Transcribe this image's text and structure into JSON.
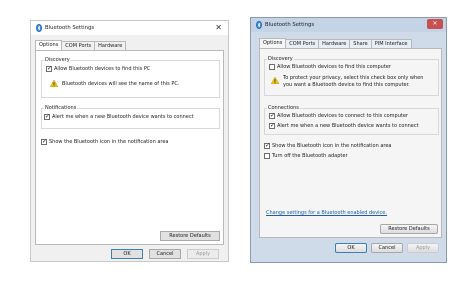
{
  "win10": {
    "title": "Bluetooth Settings",
    "close": "✕",
    "tabs": [
      "Options",
      "COM Ports",
      "Hardware"
    ],
    "discovery": {
      "label": "Discovery",
      "allow_find": "Allow Bluetooth devices to find this PC",
      "allow_find_checked": true,
      "warning": "Bluetooth devices will see the name of this PC."
    },
    "notifications": {
      "label": "Notifications",
      "alert": "Alert me when a new Bluetooth device wants to connect",
      "alert_checked": true
    },
    "show_icon": "Show the Bluetooth icon in the notification area",
    "show_icon_checked": true,
    "restore": "Restore Defaults",
    "ok": "OK",
    "cancel": "Cancel",
    "apply": "Apply"
  },
  "win7": {
    "title": "Bluetooth Settings",
    "close": "✕",
    "tabs": [
      "Options",
      "COM Ports",
      "Hardware",
      "Share",
      "PIM Interface"
    ],
    "discovery": {
      "label": "Discovery",
      "allow_find": "Allow Bluetooth devices to find this computer",
      "allow_find_checked": false,
      "warning_line1": "To protect your privacy, select this check box only when",
      "warning_line2": "you want a Bluetooth device to find this computer."
    },
    "connections": {
      "label": "Connections",
      "allow_connect": "Allow Bluetooth devices to connect to this computer",
      "allow_connect_checked": true,
      "alert": "Alert me when a new Bluetooth device wants to connect",
      "alert_checked": true
    },
    "show_icon": "Show the Bluetooth icon in the notification area",
    "show_icon_checked": true,
    "turn_off": "Turn off the Bluetooth adapter",
    "turn_off_checked": false,
    "change_link": "Change settings for a Bluetooth enabled device.",
    "restore": "Restore Defaults",
    "ok": "OK",
    "cancel": "Cancel",
    "apply": "Apply"
  }
}
